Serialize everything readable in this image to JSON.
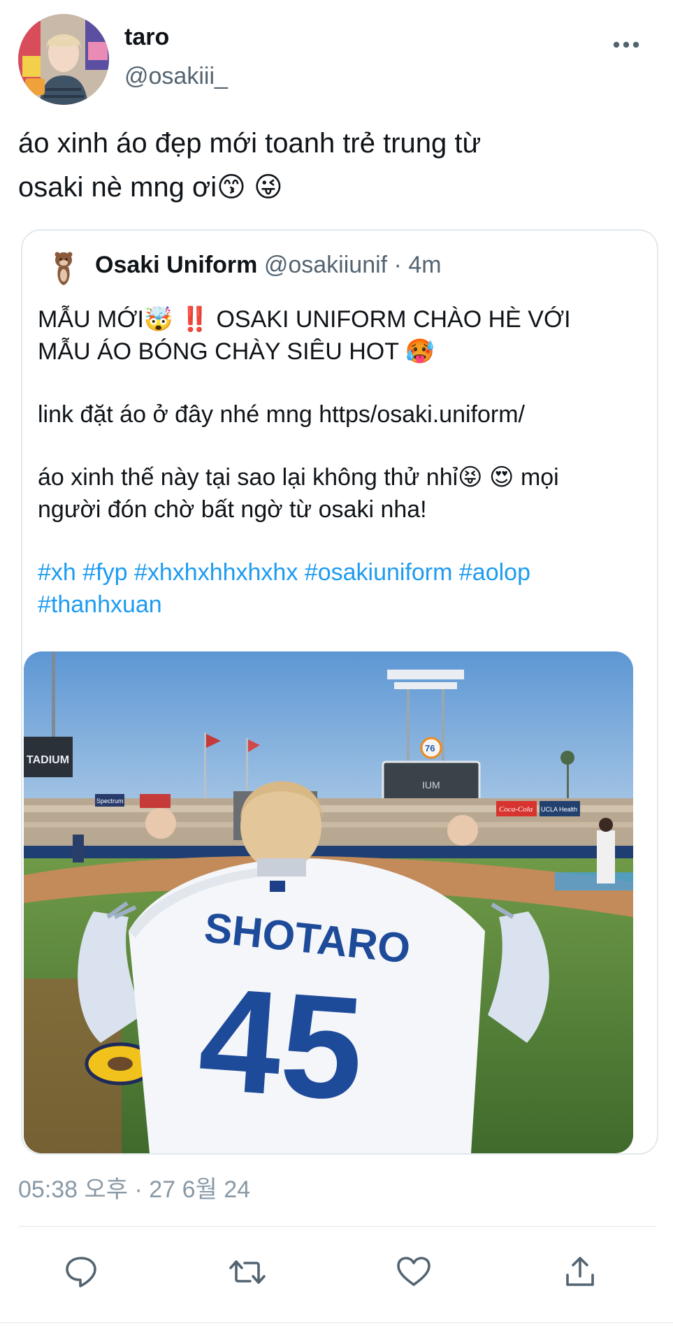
{
  "tweet": {
    "display_name": "taro",
    "handle": "@osakiii_",
    "text_line1": "áo xinh áo đẹp mới toanh trẻ trung từ",
    "text_line2": "osaki nè mng ơi😙 😜",
    "timestamp": "05:38 오후 · 27 6월 24"
  },
  "quote": {
    "display_name": "Osaki Uniform",
    "handle": "@osakiiunif",
    "separator": " · ",
    "time": "4m",
    "line1": "MẪU MỚI🤯 ‼️  OSAKI UNIFORM CHÀO HÈ VỚI",
    "line2": "MẪU ÁO BÓNG CHÀY SIÊU HOT 🥵",
    "link_line": "link đặt áo ở đây nhé mng https/osaki.uniform/",
    "line3": "áo xinh thế này tại sao lại không thử nhỉ😝 😍 mọi",
    "line4": "người đón chờ bất ngờ từ osaki nha!",
    "hashtags_line1": "#xh #fyp #xhxhxhhxhxhx #osakiuniform #aolop",
    "hashtags_line2": "#thanhxuan",
    "photo": {
      "jersey_name": "SHOTARO",
      "jersey_number": "45",
      "stadium_sign": "TADIUM",
      "badge_76": "76",
      "scoreboard_text": "IUM",
      "board_coca_cola": "Coca-Cola",
      "board_health": "UCLA Health",
      "board_spectrum": "Spectrum"
    }
  },
  "icons": {
    "more": "more-icon",
    "reply": "reply-icon",
    "retweet": "retweet-icon",
    "like": "like-icon",
    "share": "share-icon"
  },
  "colors": {
    "link": "#1d9bf0",
    "secondary": "#536471",
    "timestamp": "#8899a6",
    "border": "#e1e8ed"
  }
}
